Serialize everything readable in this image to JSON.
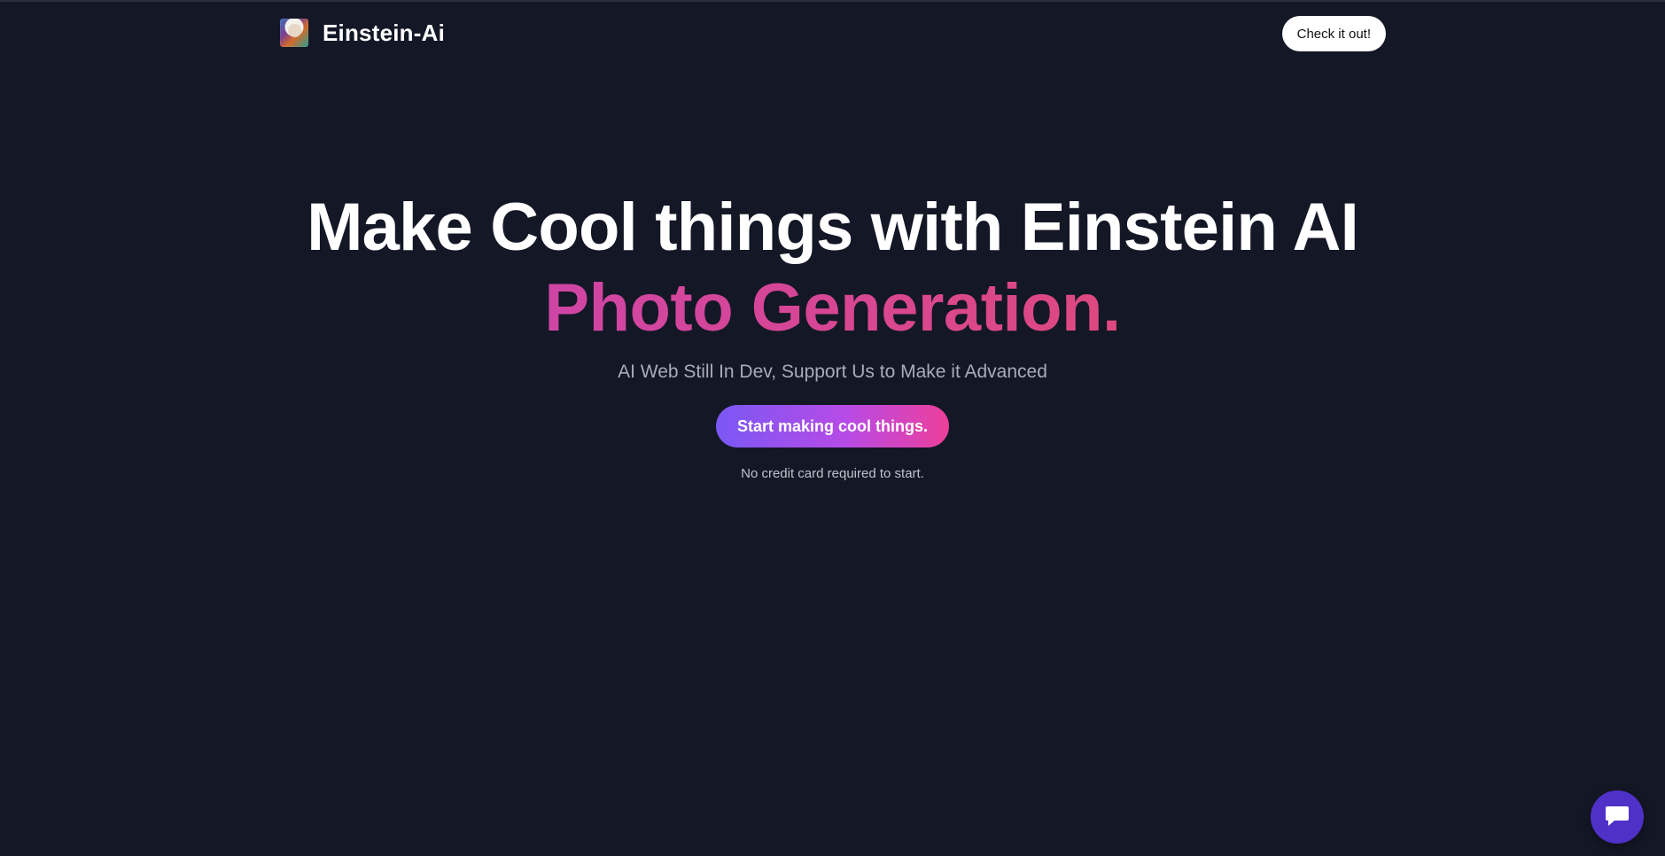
{
  "nav": {
    "brand_name": "Einstein-Ai",
    "logo_icon": "einstein-portrait-logo",
    "check_label": "Check it out!"
  },
  "hero": {
    "headline": "Make Cool things with Einstein AI",
    "headline_accent": "Photo Generation.",
    "subtitle": "AI Web Still In Dev, Support Us to Make it Advanced",
    "cta_label": "Start making cool things.",
    "note": "No credit card required to start."
  },
  "chat": {
    "icon": "chat-icon"
  },
  "colors": {
    "background": "#141726",
    "accent_gradient_start": "#7a58f4",
    "accent_gradient_end": "#ee3f9a",
    "headline_accent_start": "#c042c6",
    "headline_accent_end": "#e94f55",
    "chat_button": "#4f31c8"
  }
}
